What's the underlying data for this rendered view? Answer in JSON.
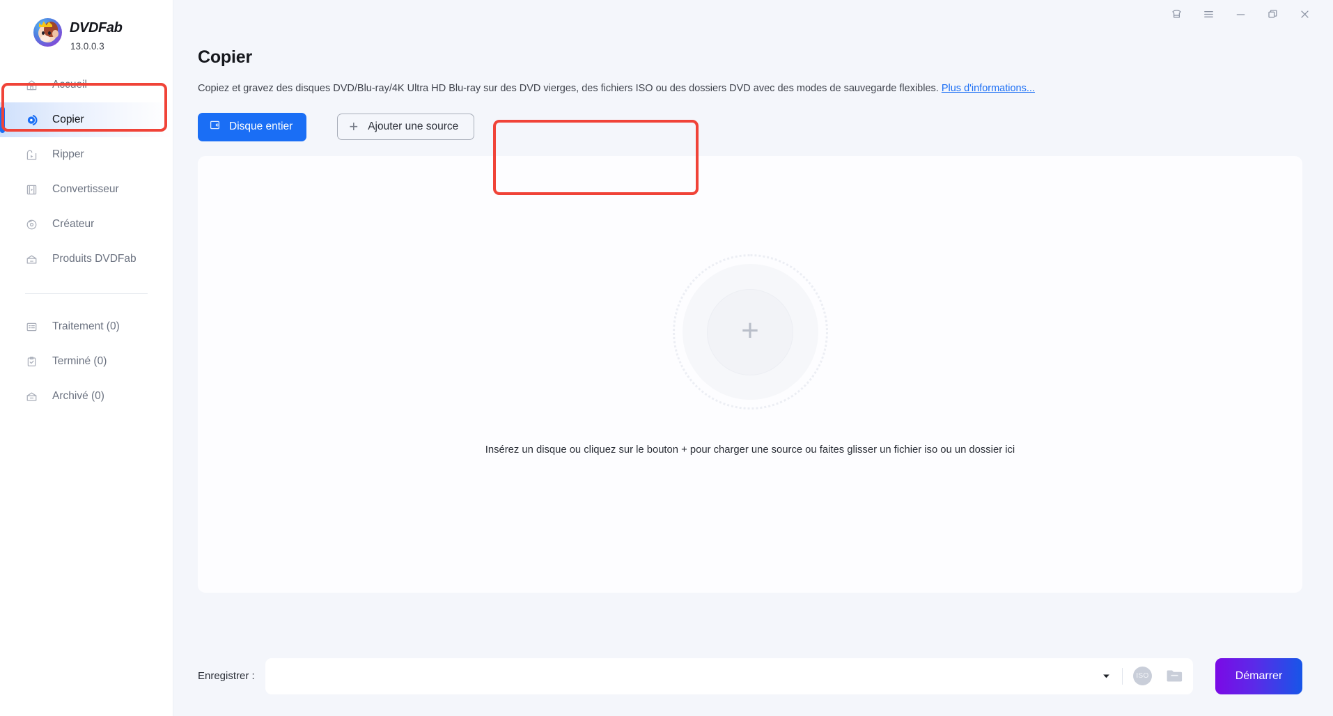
{
  "app": {
    "brand_name": "DVDFab",
    "version": "13.0.0.3",
    "avatar_icon": "monkey-avatar-icon"
  },
  "titlebar": {
    "buttons": [
      {
        "name": "theme-skin-icon",
        "label": ""
      },
      {
        "name": "menu-icon",
        "label": ""
      },
      {
        "name": "minimize-icon",
        "label": ""
      },
      {
        "name": "maximize-restore-icon",
        "label": ""
      },
      {
        "name": "close-icon",
        "label": ""
      }
    ]
  },
  "sidebar": {
    "items": [
      {
        "label": "Accueil",
        "icon": "home-icon",
        "active": false
      },
      {
        "label": "Copier",
        "icon": "copy-disc-icon",
        "active": true
      },
      {
        "label": "Ripper",
        "icon": "ripper-icon",
        "active": false
      },
      {
        "label": "Convertisseur",
        "icon": "film-icon",
        "active": false
      },
      {
        "label": "Créateur",
        "icon": "disc-icon",
        "active": false
      },
      {
        "label": "Produits DVDFab",
        "icon": "products-box-icon",
        "active": false
      }
    ],
    "secondary_items": [
      {
        "label": "Traitement (0)",
        "icon": "task-list-icon"
      },
      {
        "label": "Terminé (0)",
        "icon": "clipboard-check-icon"
      },
      {
        "label": "Archivé (0)",
        "icon": "archive-box-icon"
      }
    ]
  },
  "main": {
    "page_title": "Copier",
    "description": "Copiez et gravez des disques DVD/Blu-ray/4K Ultra HD Blu-ray sur des DVD vierges, des fichiers ISO ou des dossiers DVD avec des modes de sauvegarde flexibles.",
    "more_link": "Plus d'informations...",
    "mode_button": "Disque entier",
    "mode_button_icon": "full-disc-icon",
    "add_source_button": "Ajouter une source",
    "add_source_icon": "plus-icon",
    "drop_zone_icon": "plus-icon",
    "drop_hint": "Insérez un disque ou cliquez sur le bouton +  pour charger une source ou faites glisser un fichier iso ou un dossier ici"
  },
  "bottom": {
    "save_label": "Enregistrer :",
    "save_value": "",
    "save_placeholder": "",
    "dropdown_icon": "chevron-down-icon",
    "iso_icon_label": "ISO",
    "folder_icon": "folder-icon",
    "start_button": "Démarrer"
  },
  "colors": {
    "accent_blue": "#1a6ef5",
    "start_gradient_from": "#7b0ae6",
    "start_gradient_to": "#1756e8",
    "annotation_red": "#f04338",
    "app_background": "#f4f6fb",
    "panel_background": "#fdfdff"
  }
}
